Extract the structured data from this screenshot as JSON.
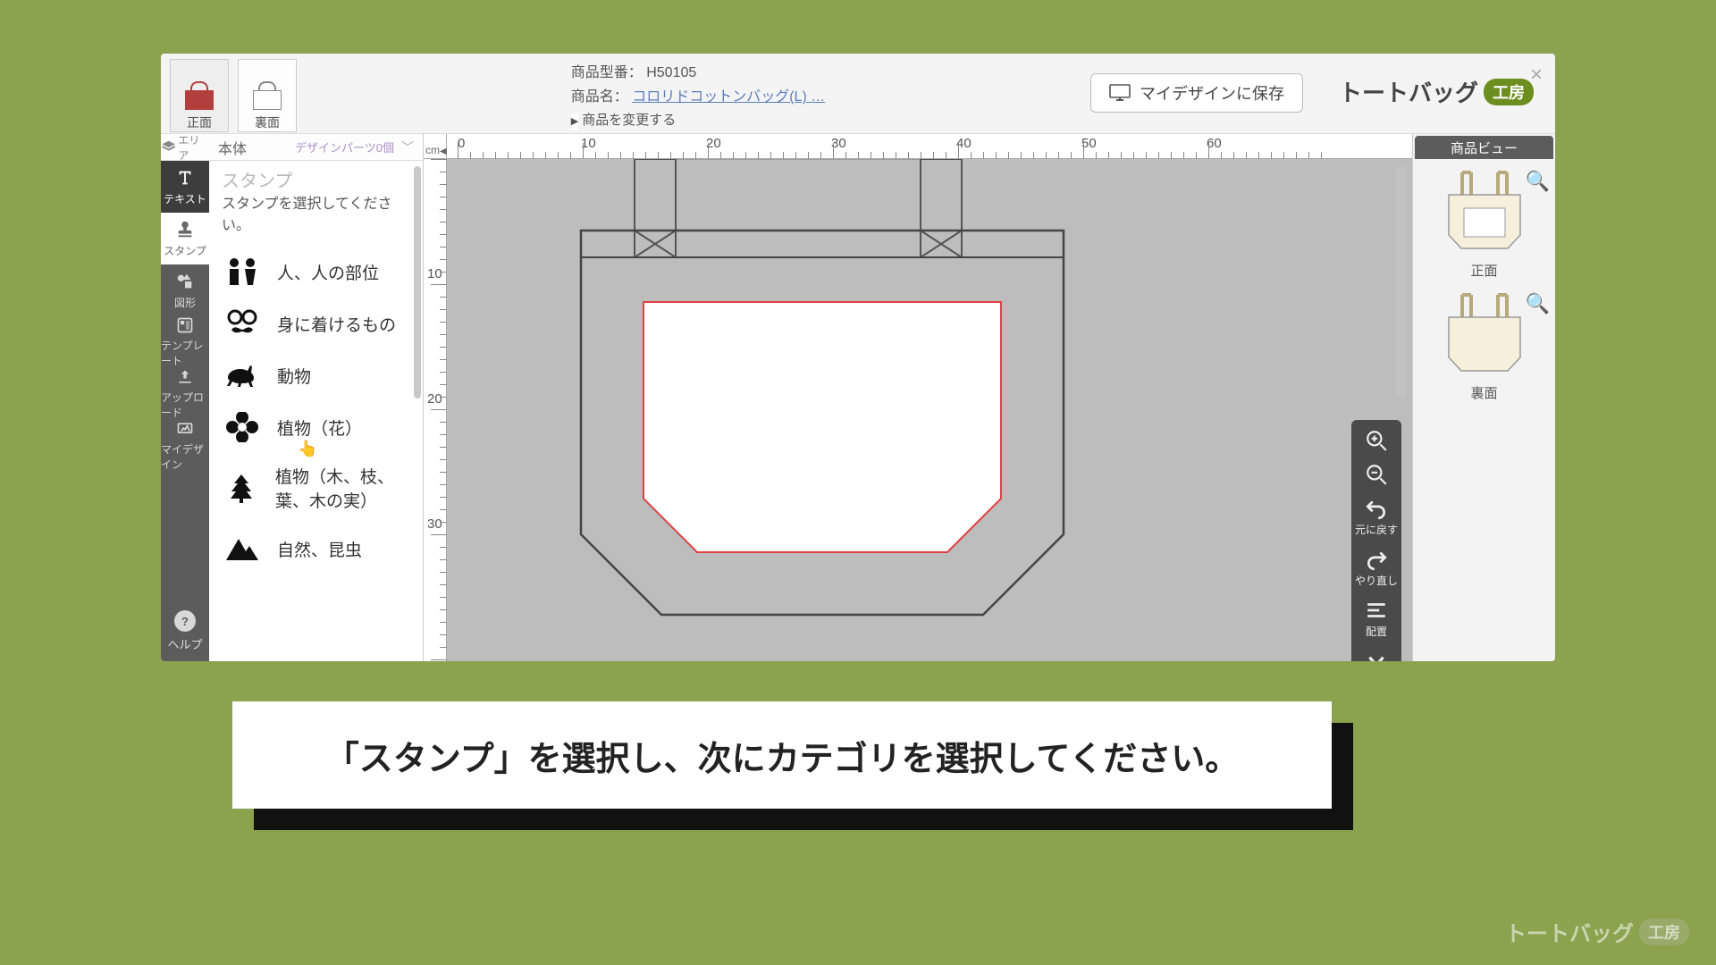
{
  "header": {
    "tabs": {
      "front": "正面",
      "back": "裏面"
    },
    "product_code_label": "商品型番：",
    "product_code": "H50105",
    "product_name_label": "商品名：",
    "product_name": "コロリドコットンバッグ(L) …",
    "change_product": "商品を変更する",
    "save_button": "マイデザインに保存",
    "brand_text": "トートバッグ",
    "brand_pill": "工房"
  },
  "left_tools": {
    "area_cap": "エリア",
    "items": {
      "text": "テキスト",
      "stamp": "スタンプ",
      "shape": "図形",
      "template": "テンプレート",
      "upload": "アップロード",
      "mydesign": "マイデザイン"
    },
    "help": "ヘルプ"
  },
  "stamp_panel": {
    "top_label": "本体",
    "parts_label": "デザインパーツ0個",
    "title": "スタンプ",
    "subtitle": "スタンプを選択してください。",
    "categories": [
      "人、人の部位",
      "身に着けるもの",
      "動物",
      "植物（花）",
      "植物（木、枝、葉、木の実）",
      "自然、昆虫"
    ]
  },
  "ruler": {
    "unit": "cm",
    "h_arrow": "◀",
    "h_ticks": [
      "0",
      "10",
      "20",
      "30",
      "40",
      "50",
      "60"
    ],
    "v_ticks": [
      "10",
      "20",
      "30"
    ]
  },
  "palette": {
    "undo": "元に戻す",
    "redo": "やり直し",
    "align": "配置"
  },
  "product_view": {
    "title": "商品ビュー",
    "front": "正面",
    "back": "裏面"
  },
  "caption": "「スタンプ」を選択し、次にカテゴリを選択してください。",
  "brand_footer": {
    "text": "トートバッグ",
    "pill": "工房"
  },
  "colors": {
    "accent_green": "#6c8e1f",
    "bag_red": "#b33e3e",
    "print_area": "#e04040"
  }
}
